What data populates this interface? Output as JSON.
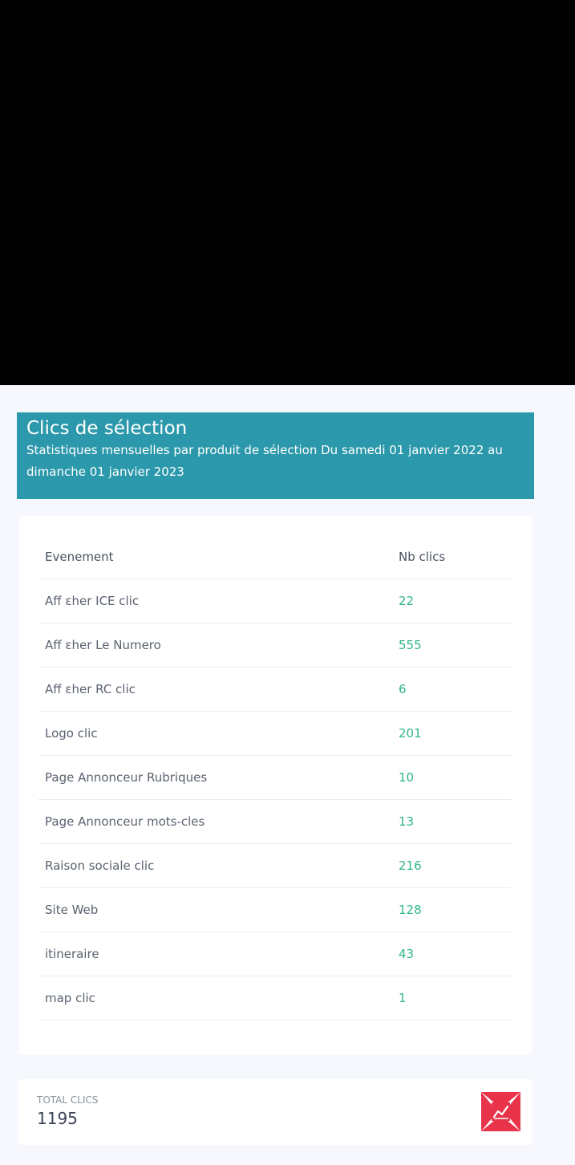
{
  "header": {
    "title": "Clics de sélection",
    "subtitle": "Statistiques mensuelles par produit de sélection Du samedi 01 janvier 2022 au dimanche 01 janvier 2023"
  },
  "table": {
    "columns": [
      "Evenement",
      "Nb clics"
    ],
    "rows": [
      {
        "event": "Aff ɛher ICE clic",
        "clicks": "22"
      },
      {
        "event": "Aff ɛher Le Numero",
        "clicks": "555"
      },
      {
        "event": "Aff ɛher RC clic",
        "clicks": "6"
      },
      {
        "event": "Logo clic",
        "clicks": "201"
      },
      {
        "event": "Page Annonceur Rubriques",
        "clicks": "10"
      },
      {
        "event": "Page Annonceur mots-cles",
        "clicks": "13"
      },
      {
        "event": "Raison sociale clic",
        "clicks": "216"
      },
      {
        "event": "Site Web",
        "clicks": "128"
      },
      {
        "event": "itineraire",
        "clicks": "43"
      },
      {
        "event": "map clic",
        "clicks": "1"
      }
    ]
  },
  "total": {
    "label": "TOTAL CLICS",
    "value": "1195",
    "icon": "chart-line-icon"
  },
  "colors": {
    "banner": "#2c98ab",
    "clicks_value": "#2fb785",
    "icon_accent": "#e8334a"
  }
}
